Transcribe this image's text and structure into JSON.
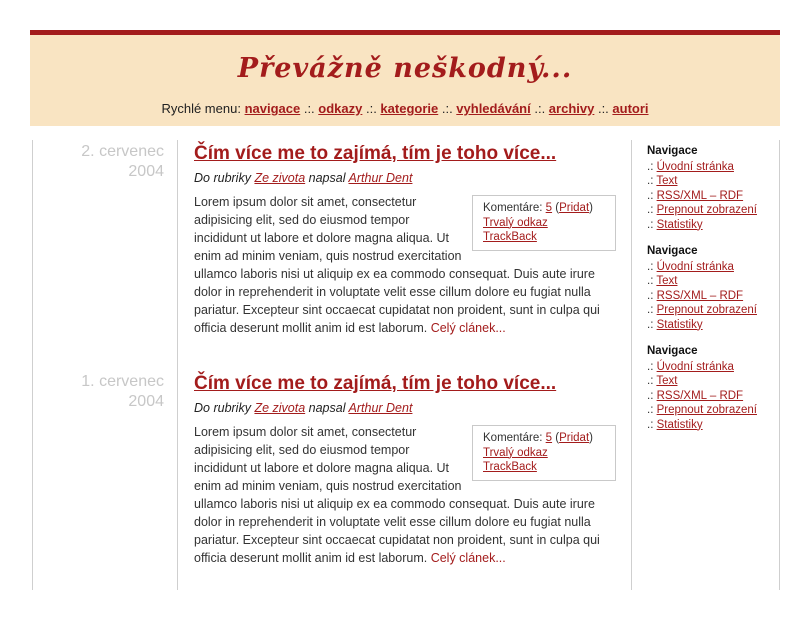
{
  "site": {
    "title": "Převážně neškodný..."
  },
  "quickmenu": {
    "label": "Rychlé menu:",
    "sep": " .:. ",
    "items": [
      {
        "label": "navigace"
      },
      {
        "label": "odkazy"
      },
      {
        "label": "kategorie"
      },
      {
        "label": "vyhledávání"
      },
      {
        "label": "archivy"
      },
      {
        "label": "autori"
      }
    ]
  },
  "posts": [
    {
      "date_line1": "2. cervenec",
      "date_line2": "2004",
      "title": "Čím více me to zajímá, tím je toho více...",
      "meta_prefix": "Do rubriky",
      "category": "Ze zivota",
      "meta_mid": "napsal",
      "author": "Arthur Dent",
      "comments_label": "Komentáre:",
      "comments_count": "5",
      "comments_add": "Pridat",
      "permalink": "Trvalý odkaz",
      "trackback": "TrackBack",
      "body": "Lorem ipsum dolor sit amet, consectetur adipisicing elit, sed do eiusmod tempor incididunt ut labore et dolore magna aliqua. Ut enim ad minim veniam, quis nostrud exercitation ullamco laboris nisi ut aliquip ex ea commodo consequat. Duis aute irure dolor in reprehenderit in voluptate velit esse cillum dolore eu fugiat nulla pariatur. Excepteur sint occaecat cupidatat non proident, sunt in culpa qui officia deserunt mollit anim id est laborum.",
      "more": "Celý clánek..."
    },
    {
      "date_line1": "1. cervenec",
      "date_line2": "2004",
      "title": "Čím více me to zajímá, tím je toho více...",
      "meta_prefix": "Do rubriky",
      "category": "Ze zivota",
      "meta_mid": "napsal",
      "author": "Arthur Dent",
      "comments_label": "Komentáre:",
      "comments_count": "5",
      "comments_add": "Pridat",
      "permalink": "Trvalý odkaz",
      "trackback": "TrackBack",
      "body": "Lorem ipsum dolor sit amet, consectetur adipisicing elit, sed do eiusmod tempor incididunt ut labore et dolore magna aliqua. Ut enim ad minim veniam, quis nostrud exercitation ullamco laboris nisi ut aliquip ex ea commodo consequat. Duis aute irure dolor in reprehenderit in voluptate velit esse cillum dolore eu fugiat nulla pariatur. Excepteur sint occaecat cupidatat non proident, sunt in culpa qui officia deserunt mollit anim id est laborum.",
      "more": "Celý clánek..."
    }
  ],
  "sidebar": {
    "prefix": ".:",
    "blocks": [
      {
        "heading": "Navigace",
        "items": [
          "Úvodní stránka",
          "Text",
          "RSS/XML – RDF",
          "Prepnout zobrazení",
          "Statistiky"
        ]
      },
      {
        "heading": "Navigace",
        "items": [
          "Úvodní stránka",
          "Text",
          "RSS/XML – RDF",
          "Prepnout zobrazení",
          "Statistiky"
        ]
      },
      {
        "heading": "Navigace",
        "items": [
          "Úvodní stránka",
          "Text",
          "RSS/XML – RDF",
          "Prepnout zobrazení",
          "Statistiky"
        ]
      }
    ]
  },
  "colors": {
    "accent": "#a31c1c",
    "header_bg": "#f9e4c2",
    "date_gray": "#c7c7c7"
  }
}
